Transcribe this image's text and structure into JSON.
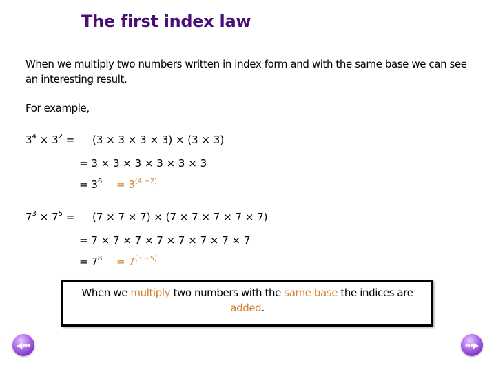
{
  "title": "The first index law",
  "intro": "When we multiply two numbers written in index form and with the same base we can see an interesting result.",
  "for_example": "For example,",
  "example1": {
    "lhs_base1": "3",
    "lhs_exp1": "4",
    "times": "×",
    "lhs_base2": "3",
    "lhs_exp2": "2",
    "eq": "=",
    "expanded": "(3 × 3 × 3 × 3) × (3 × 3)",
    "line2": "= 3 × 3 × 3 × 3 × 3 × 3",
    "result_prefix": "= 3",
    "result_exp": "6",
    "rule_prefix": "= 3",
    "rule_exp": "(4 +2)"
  },
  "example2": {
    "lhs_base1": "7",
    "lhs_exp1": "3",
    "times": "×",
    "lhs_base2": "7",
    "lhs_exp2": "5",
    "eq": "=",
    "expanded": "(7 × 7 × 7) × (7 × 7 × 7 × 7 × 7)",
    "line2": "= 7 × 7 × 7 × 7 × 7 × 7 × 7 × 7",
    "result_prefix": "= 7",
    "result_exp": "8",
    "rule_prefix": "= 7",
    "rule_exp": "(3 +5)"
  },
  "rule": {
    "part1": "When we ",
    "highlight1": "multiply",
    "part2": " two numbers with the ",
    "highlight2": "same base",
    "part3": " the indices are ",
    "highlight3": "added",
    "part4": "."
  },
  "nav": {
    "prev_icon": "◀•••",
    "next_icon": "•••▶"
  },
  "colors": {
    "title": "#4b0f78",
    "highlight": "#d6802e",
    "nav_button": "#9b4fdc"
  }
}
